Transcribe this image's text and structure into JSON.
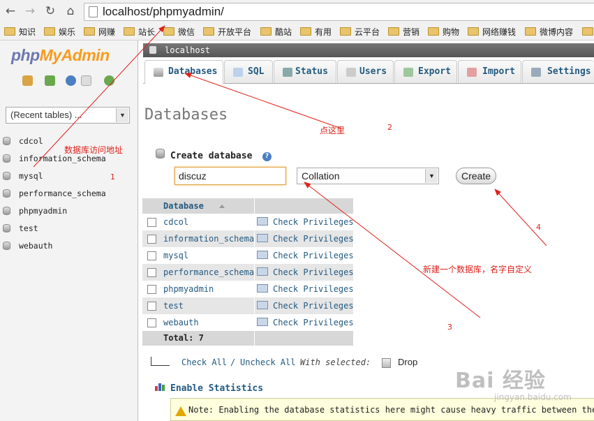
{
  "browser": {
    "url": "localhost/phpmyadmin/",
    "bookmarks": [
      "知识",
      "娱乐",
      "网赚",
      "站长",
      "微信",
      "开放平台",
      "酷站",
      "有用",
      "云平台",
      "营销",
      "购物",
      "网络赚钱",
      "微博内容"
    ]
  },
  "sidebar": {
    "logo": {
      "php": "php",
      "my": "My",
      "admin": "Admin"
    },
    "recent_tables": "(Recent tables) ...",
    "databases": [
      "cdcol",
      "information_schema",
      "mysql",
      "performance_schema",
      "phpmyadmin",
      "test",
      "webauth"
    ]
  },
  "server": {
    "name": "localhost"
  },
  "tabs": [
    "Databases",
    "SQL",
    "Status",
    "Users",
    "Export",
    "Import",
    "Settings"
  ],
  "main": {
    "page_title": "Databases",
    "create_database_label": "Create database",
    "db_name_value": "discuz",
    "collation_value": "Collation",
    "create_button": "Create",
    "table": {
      "header": "Database",
      "rows": [
        {
          "name": "cdcol",
          "action": "Check Privileges"
        },
        {
          "name": "information_schema",
          "action": "Check Privileges"
        },
        {
          "name": "mysql",
          "action": "Check Privileges"
        },
        {
          "name": "performance_schema",
          "action": "Check Privileges"
        },
        {
          "name": "phpmyadmin",
          "action": "Check Privileges"
        },
        {
          "name": "test",
          "action": "Check Privileges"
        },
        {
          "name": "webauth",
          "action": "Check Privileges"
        }
      ],
      "total": "Total: 7"
    },
    "check_all": "Check All",
    "separator": "/",
    "uncheck_all": "Uncheck All",
    "with_selected": "With selected:",
    "drop": "Drop",
    "enable_statistics": "Enable Statistics",
    "note": "Note: Enabling the database statistics here might cause heavy traffic between the w"
  },
  "annotations": {
    "db_access_address": "数据库访问地址",
    "n1": "1",
    "click_here": "点这里",
    "n2": "2",
    "new_db": "新建一个数据库，名字自定义",
    "n3": "3",
    "n4": "4"
  },
  "watermark": {
    "big": "Bai 经验",
    "small": "jingyan.baidu.com"
  },
  "colors": {
    "link": "#235a81",
    "annotation": "#e0201a",
    "logo_blue": "#6c78af",
    "logo_orange": "#f89c1c"
  }
}
